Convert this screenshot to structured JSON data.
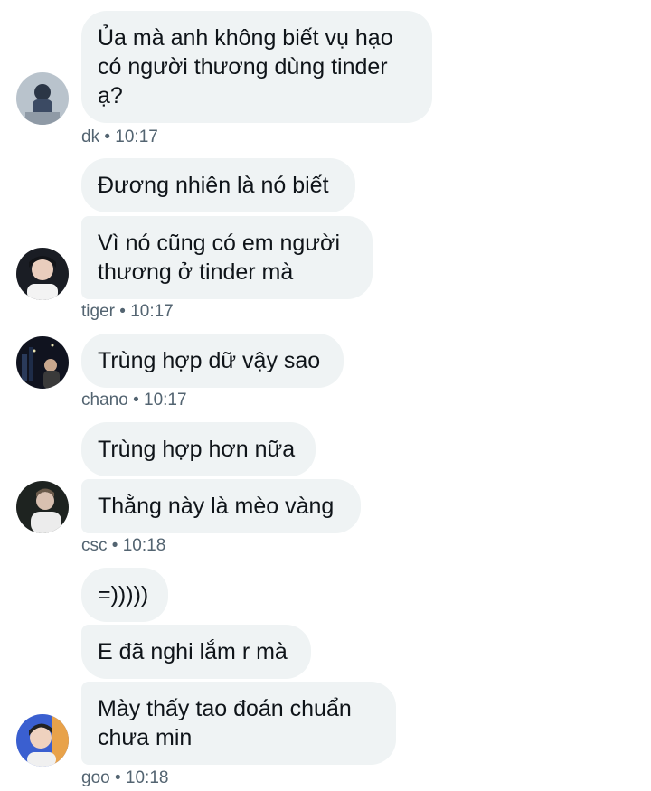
{
  "groups": [
    {
      "avatar": "avatar-dk",
      "messages": [
        "Ủa mà anh không biết vụ hạo\ncó người thương dùng tinder\nạ?"
      ],
      "name": "dk",
      "time": "10:17"
    },
    {
      "avatar": "avatar-tiger",
      "messages": [
        "Đương nhiên là nó biết",
        "Vì nó cũng có em người\nthương ở tinder mà"
      ],
      "name": "tiger",
      "time": "10:17"
    },
    {
      "avatar": "avatar-chano",
      "messages": [
        "Trùng hợp dữ vậy sao"
      ],
      "name": "chano",
      "time": "10:17"
    },
    {
      "avatar": "avatar-csc",
      "messages": [
        "Trùng hợp hơn nữa",
        "Thằng này là mèo vàng"
      ],
      "name": "csc",
      "time": "10:18"
    },
    {
      "avatar": "avatar-goo",
      "messages": [
        "=)))))",
        "E đã nghi lắm r mà",
        "Mày thấy tao đoán chuẩn\nchưa min"
      ],
      "name": "goo",
      "time": "10:18"
    }
  ],
  "separator": "•",
  "colors": {
    "bubble": "#eff3f4",
    "text": "#0f1419",
    "meta": "#536471"
  }
}
